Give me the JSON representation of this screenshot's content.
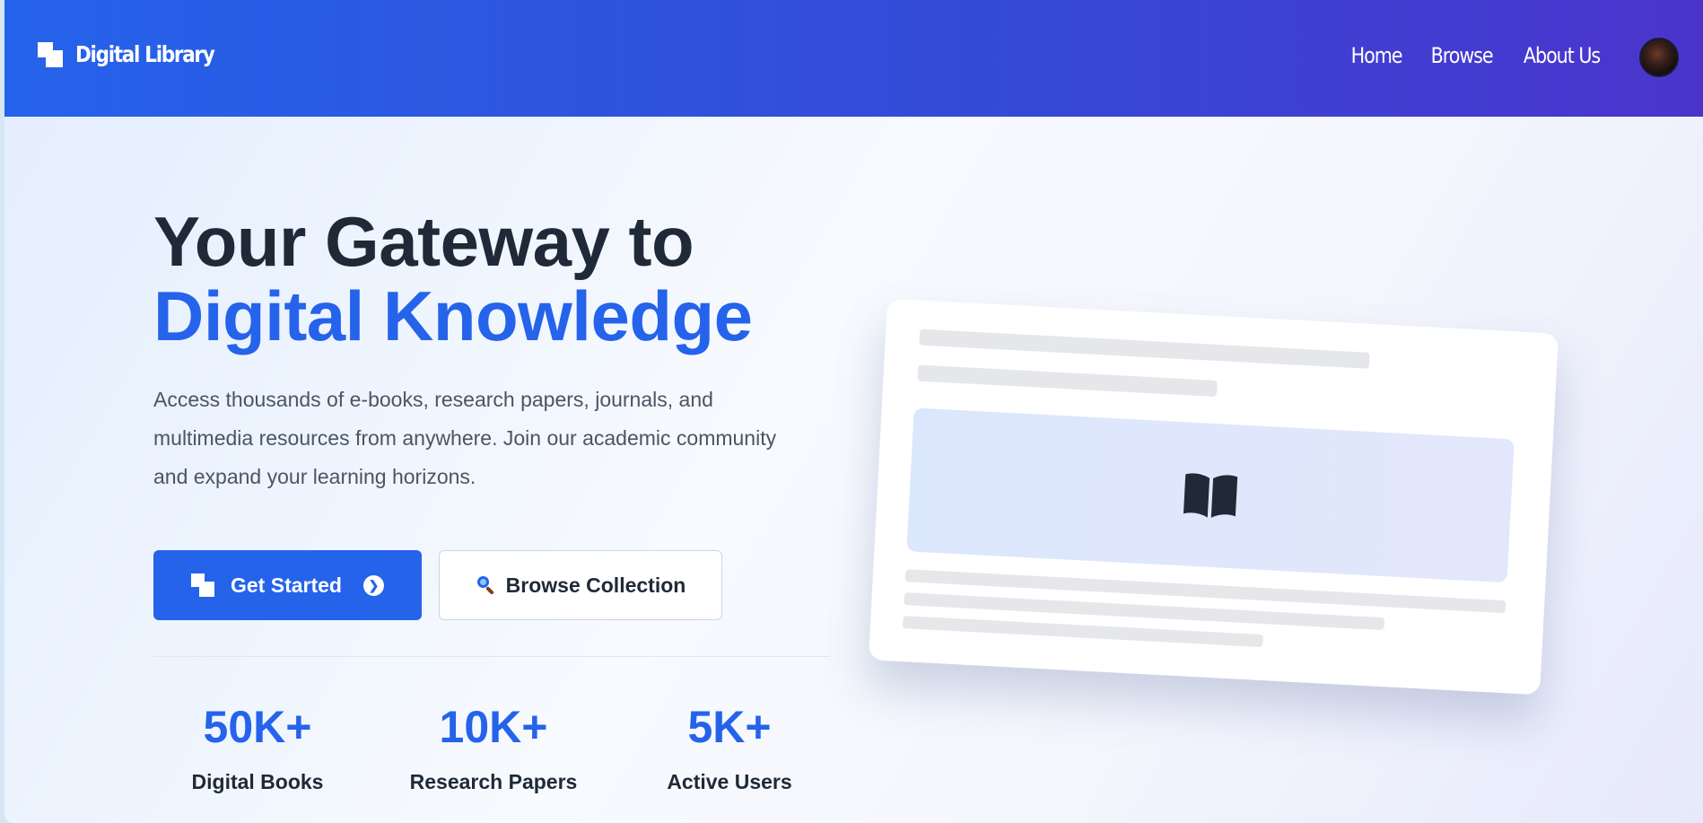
{
  "brand": {
    "name": "Digital Library",
    "icon": "logo-squares-icon"
  },
  "nav": {
    "items": [
      {
        "label": "Home"
      },
      {
        "label": "Browse"
      },
      {
        "label": "About Us"
      }
    ],
    "avatar": "user-avatar"
  },
  "hero": {
    "title_line1": "Your Gateway to",
    "title_line2": "Digital Knowledge",
    "description": "Access thousands of e-books, research papers, journals, and multimedia resources from anywhere. Join our academic community and expand your learning horizons.",
    "primary_button": {
      "label": "Get Started",
      "icon": "logo-squares-icon",
      "trailing_icon": "arrow-right-circle-icon"
    },
    "secondary_button": {
      "label": "Browse Collection",
      "icon": "magnifier-icon"
    }
  },
  "stats": [
    {
      "value": "50K+",
      "label": "Digital Books"
    },
    {
      "value": "10K+",
      "label": "Research Papers"
    },
    {
      "value": "5K+",
      "label": "Active Users"
    }
  ],
  "mockup": {
    "icon": "open-book-icon"
  },
  "colors": {
    "accent": "#2563eb",
    "nav_gradient_start": "#2563eb",
    "nav_gradient_end": "#4b34cc",
    "title_dark": "#1f2937",
    "body_text": "#4b5563"
  }
}
